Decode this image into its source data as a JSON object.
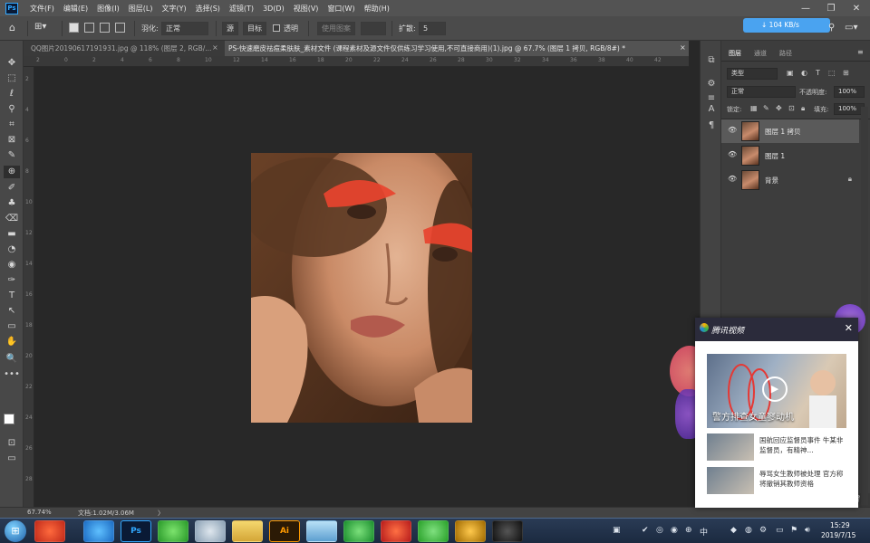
{
  "app": {
    "logo": "Ps"
  },
  "menu": [
    "文件(F)",
    "编辑(E)",
    "图像(I)",
    "图层(L)",
    "文字(Y)",
    "选择(S)",
    "滤镜(T)",
    "3D(D)",
    "视图(V)",
    "窗口(W)",
    "帮助(H)"
  ],
  "window_controls": {
    "minimize": "—",
    "restore": "❐",
    "close": "✕"
  },
  "options_bar": {
    "feather_label": "羽化:",
    "mode_label": "正常",
    "mode_buttons": [
      "源",
      "目标"
    ],
    "transparent_label": "透明",
    "use_pattern_label": "使用图案",
    "diffusion_label": "扩散:",
    "diffusion_value": "5"
  },
  "speed_badge": "↓ 104 KB/s",
  "tabs": [
    {
      "label": "QQ图片20190617191931.jpg @ 118% (图层 2, RGB/...",
      "close": "×",
      "active": false
    },
    {
      "label": "PS-快速磨皮祛痘柔肤肤_素材文件 (课程素材及源文件仅供练习学习使用,不可直接商用)(1).jpg @ 67.7% (图层 1 拷贝, RGB/8#) *",
      "close": "×",
      "active": true
    }
  ],
  "tools": [
    "✥",
    "⬚",
    "ℓ",
    "⚲",
    "⌗",
    "⊠",
    "✎",
    "⊕",
    "✐",
    "♣",
    "⌫",
    "▬",
    "◔",
    "◉",
    "✑",
    "T",
    "↖",
    "▭",
    "✋",
    "🔍",
    "•••"
  ],
  "ruler_top": [
    "2",
    "0",
    "2",
    "4",
    "6",
    "8",
    "10",
    "12",
    "14",
    "16",
    "18",
    "20",
    "22",
    "24",
    "26",
    "28",
    "30",
    "32",
    "34",
    "36",
    "38",
    "40",
    "42"
  ],
  "ruler_left": [
    "2",
    "4",
    "6",
    "8",
    "10",
    "12",
    "14",
    "16",
    "18",
    "20",
    "22",
    "24",
    "26",
    "28"
  ],
  "status": {
    "zoom": "67.74%",
    "doc": "文档:1.02M/3.06M",
    "arrow": "〉"
  },
  "panel": {
    "tabs": [
      "图层",
      "通道",
      "路径"
    ],
    "kind_label": "类型",
    "blend_mode": "正常",
    "opacity_label": "不透明度:",
    "opacity_value": "100%",
    "lock_label": "锁定:",
    "fill_label": "填充:",
    "fill_value": "100%",
    "layers": [
      {
        "name": "图层 1 拷贝",
        "selected": true,
        "locked": false
      },
      {
        "name": "图层 1",
        "selected": false,
        "locked": false
      },
      {
        "name": "背景",
        "selected": false,
        "locked": true
      }
    ]
  },
  "popup": {
    "title": "腾讯视频",
    "close": "✕",
    "hero_caption": "警方排查女童寥动机",
    "news": [
      {
        "text": "国航回应监督员事件 牛某非监督员，有精神..."
      },
      {
        "text": "辱骂女生教师被处理 官方称将撤销其教师资格"
      }
    ]
  },
  "taskbar": {
    "apps": [
      "",
      "",
      "Ps",
      "",
      "",
      "",
      "Ai",
      "",
      "",
      "",
      "",
      "",
      ""
    ],
    "clock_time": "15:29",
    "clock_date": "2019/7/15"
  }
}
